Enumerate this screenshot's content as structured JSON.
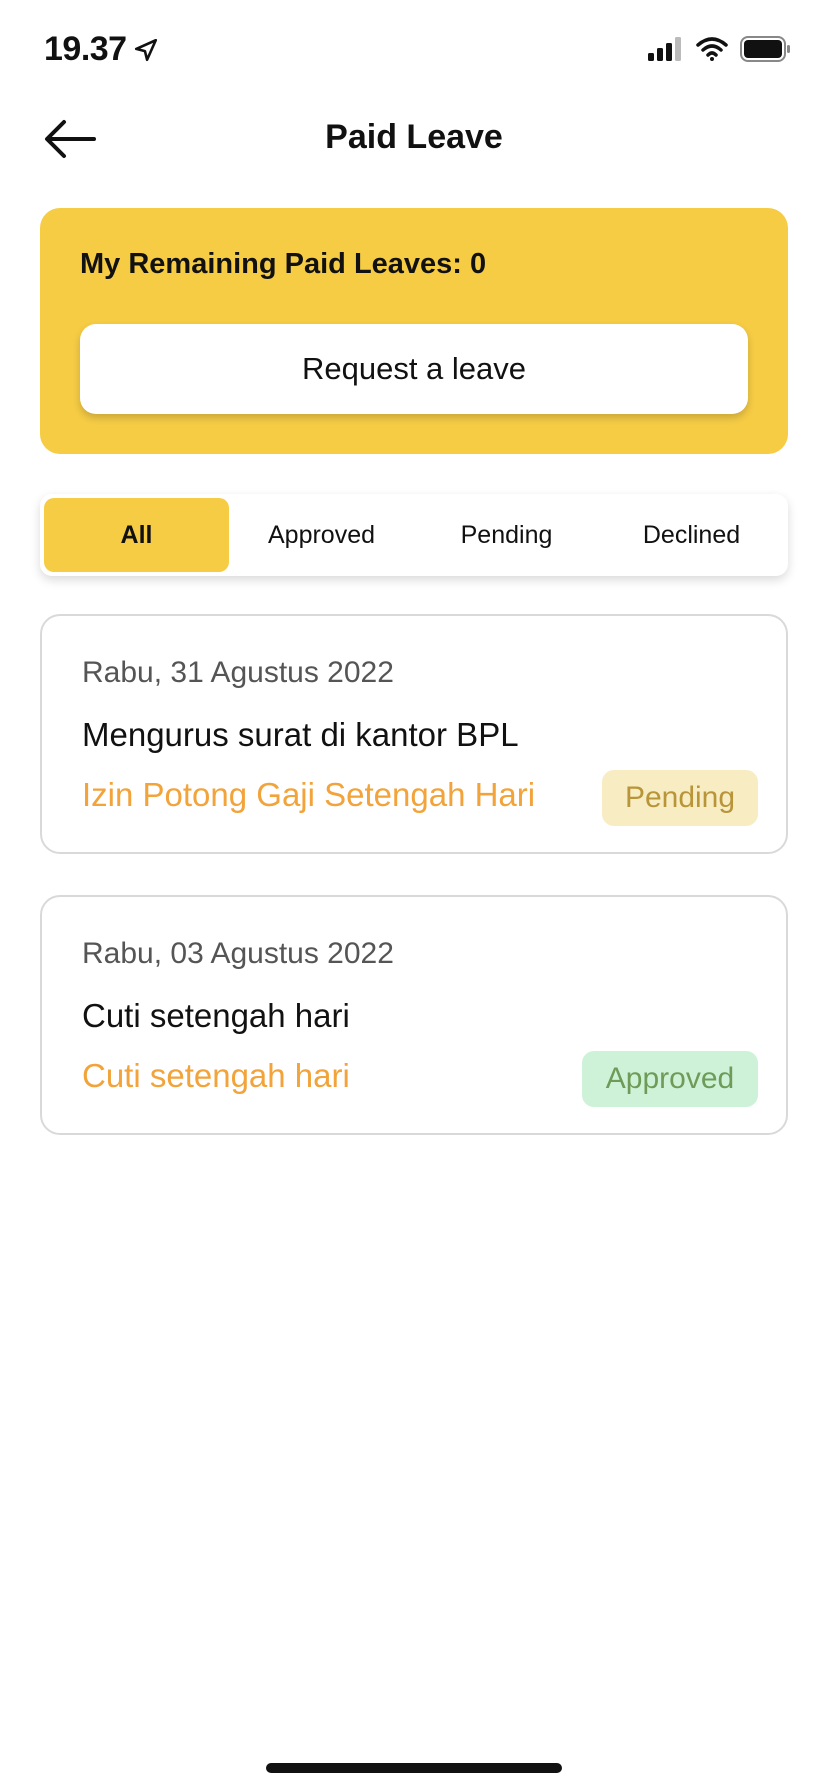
{
  "status_bar": {
    "time": "19.37",
    "icons": [
      "location-arrow-icon",
      "cellular-signal-icon",
      "wifi-icon",
      "battery-icon"
    ]
  },
  "header": {
    "title": "Paid Leave",
    "back_icon": "arrow-left-icon"
  },
  "summary": {
    "remaining_label": "My Remaining Paid Leaves: 0",
    "request_button_label": "Request a leave"
  },
  "tabs": [
    {
      "label": "All",
      "active": true
    },
    {
      "label": "Approved",
      "active": false
    },
    {
      "label": "Pending",
      "active": false
    },
    {
      "label": "Declined",
      "active": false
    }
  ],
  "leaves": [
    {
      "date": "Rabu, 31 Agustus 2022",
      "title": "Mengurus surat di kantor BPL",
      "type": "Izin Potong Gaji Setengah Hari",
      "status": "Pending"
    },
    {
      "date": "Rabu, 03 Agustus 2022",
      "title": "Cuti setengah hari",
      "type": "Cuti setengah hari",
      "status": "Approved"
    }
  ],
  "colors": {
    "accent": "#f6cc45",
    "type_text": "#f2a33a",
    "pending_bg": "#f8ecc2",
    "pending_text": "#b9953a",
    "approved_bg": "#cdf2d8",
    "approved_text": "#6e9c58"
  }
}
